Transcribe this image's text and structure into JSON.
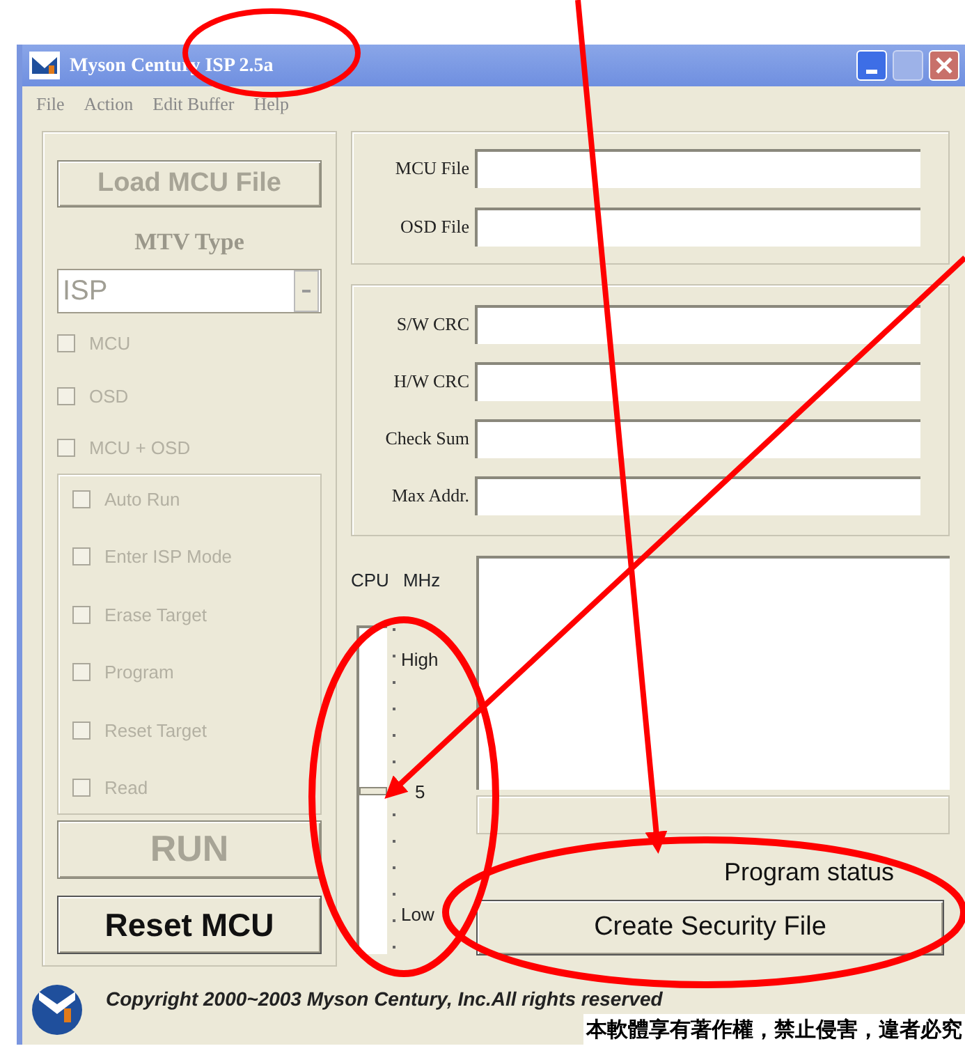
{
  "window": {
    "title": "Myson Century ISP 2.5a"
  },
  "menu": [
    "File",
    "Action",
    "Edit Buffer",
    "Help"
  ],
  "left_panel": {
    "load_button": {
      "label": "Load MCU File",
      "disabled": true
    },
    "mtv_type_label": "MTV Type",
    "mtv_type": {
      "value": "ISP",
      "disabled": true
    },
    "type_options": [
      {
        "label": "MCU",
        "checked": false,
        "disabled": true
      },
      {
        "label": "OSD",
        "checked": false,
        "disabled": true
      },
      {
        "label": "MCU + OSD",
        "checked": false,
        "disabled": true
      }
    ],
    "steps": [
      {
        "label": "Auto Run",
        "checked": false,
        "disabled": true
      },
      {
        "label": "Enter ISP Mode",
        "checked": false,
        "disabled": true
      },
      {
        "label": "Erase Target",
        "checked": false,
        "disabled": true
      },
      {
        "label": "Program",
        "checked": false,
        "disabled": true
      },
      {
        "label": "Reset Target",
        "checked": false,
        "disabled": true
      },
      {
        "label": "Read",
        "checked": false,
        "disabled": true
      }
    ],
    "run_button": {
      "label": "RUN",
      "disabled": true
    },
    "reset_button": {
      "label": "Reset MCU",
      "disabled": false
    }
  },
  "file_fields": [
    {
      "label": "MCU File"
    },
    {
      "label": "OSD File"
    }
  ],
  "info_fields": [
    {
      "label": "S/W CRC"
    },
    {
      "label": "H/W CRC"
    },
    {
      "label": "Check Sum"
    },
    {
      "label": "Max Addr."
    }
  ],
  "cpu": {
    "label": "CPU",
    "unit": "MHz",
    "high_label": "High",
    "value_label": "5",
    "low_label": "Low",
    "level": 0.5
  },
  "program_status": "Program status",
  "security_button": {
    "label": "Create Security File",
    "disabled": false
  },
  "footer": {
    "copyright": "Copyright 2000~2003 Myson Century, Inc.All rights reserved",
    "notice": "本軟體享有著作權，禁止侵害，違者必究"
  }
}
